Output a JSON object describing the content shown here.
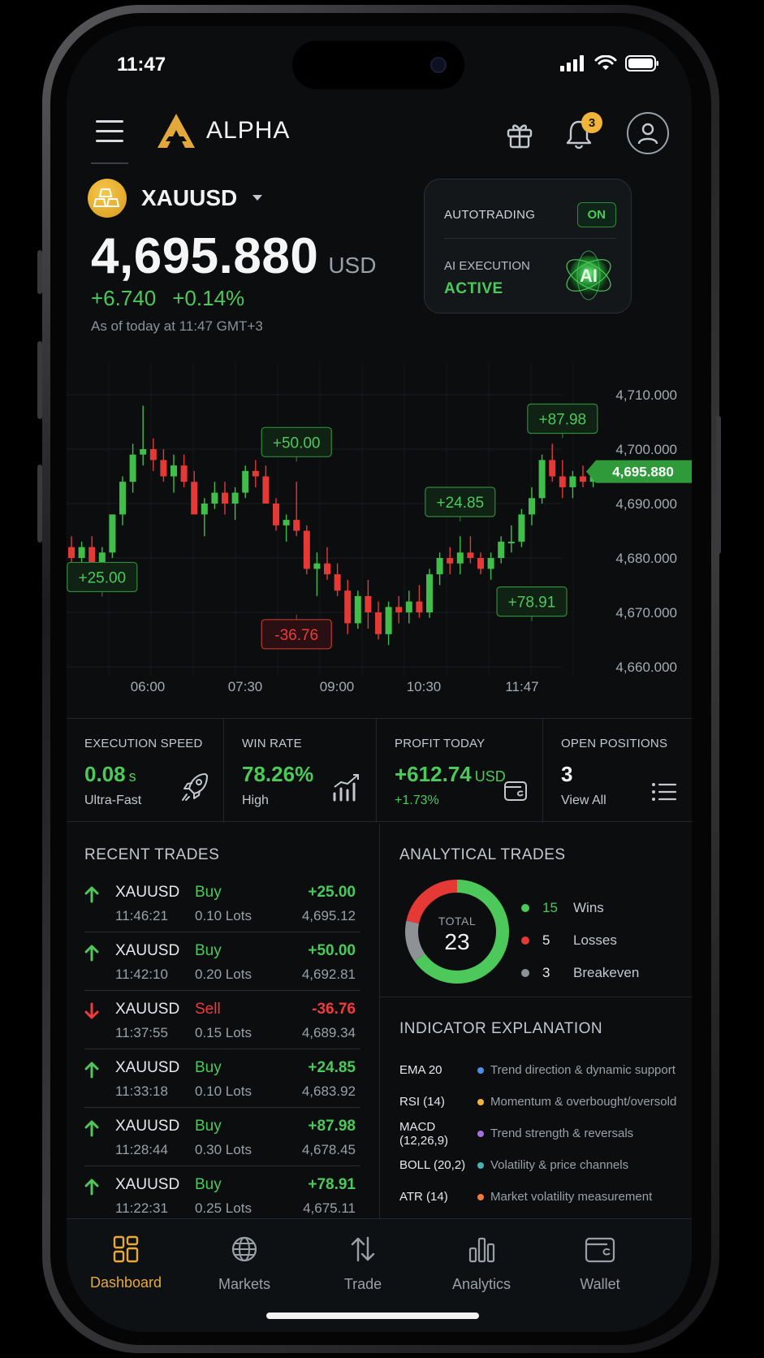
{
  "status_bar": {
    "time": "11:47"
  },
  "header": {
    "logo_text": "ALPHA",
    "notification_count": "3"
  },
  "symbol": {
    "name": "XAUUSD"
  },
  "quote": {
    "price": "4,695.880",
    "currency": "USD",
    "change_abs": "+6.740",
    "change_pct": "+0.14%",
    "as_of": "As of today at 11:47 GMT+3"
  },
  "autotrading": {
    "label": "AUTOTRADING",
    "toggle": "ON",
    "ai_label": "AI EXECUTION",
    "ai_status": "ACTIVE",
    "ai_badge": "AI"
  },
  "chart_data": {
    "type": "candlestick",
    "x_ticks": [
      "06:00",
      "07:30",
      "09:00",
      "10:30",
      "11:47"
    ],
    "y_ticks": [
      "4,710.000",
      "4,700.000",
      "4,690.000",
      "4,680.000",
      "4,670.000",
      "4,660.000"
    ],
    "ylim": [
      4660,
      4710
    ],
    "current_price_label": "4,695.880",
    "current_price": 4695.88,
    "annotations": [
      {
        "text": "+25.00",
        "color": "green",
        "idx": 3,
        "value": 4676.5
      },
      {
        "text": "+50.00",
        "color": "green",
        "idx": 22,
        "value": 4701.3
      },
      {
        "text": "-36.76",
        "color": "red",
        "idx": 22,
        "value": 4666.0
      },
      {
        "text": "+24.85",
        "color": "green",
        "idx": 38,
        "value": 4690.3
      },
      {
        "text": "+78.91",
        "color": "green",
        "idx": 45,
        "value": 4672.0
      },
      {
        "text": "+87.98",
        "color": "green",
        "idx": 48,
        "value": 4705.6
      }
    ],
    "candles": [
      [
        4682,
        4684,
        4678,
        4680
      ],
      [
        4680,
        4683,
        4678,
        4682
      ],
      [
        4682,
        4684,
        4679,
        4679
      ],
      [
        4679,
        4682,
        4677,
        4681
      ],
      [
        4681,
        4688,
        4680,
        4688
      ],
      [
        4688,
        4695,
        4686,
        4694
      ],
      [
        4694,
        4701,
        4692,
        4699
      ],
      [
        4699,
        4708,
        4697,
        4700
      ],
      [
        4700,
        4702,
        4696,
        4698
      ],
      [
        4698,
        4700,
        4694,
        4695
      ],
      [
        4695,
        4699,
        4692,
        4697
      ],
      [
        4697,
        4699,
        4693,
        4694
      ],
      [
        4694,
        4696,
        4688,
        4688
      ],
      [
        4688,
        4691,
        4684,
        4690
      ],
      [
        4690,
        4694,
        4689,
        4692
      ],
      [
        4692,
        4694,
        4688,
        4690
      ],
      [
        4690,
        4693,
        4687,
        4692
      ],
      [
        4692,
        4697,
        4691,
        4696
      ],
      [
        4696,
        4698,
        4693,
        4695
      ],
      [
        4695,
        4697,
        4690,
        4690
      ],
      [
        4690,
        4691,
        4685,
        4686
      ],
      [
        4686,
        4688,
        4683,
        4687
      ],
      [
        4687,
        4694,
        4684,
        4685
      ],
      [
        4685,
        4686,
        4677,
        4678
      ],
      [
        4678,
        4681,
        4673,
        4679
      ],
      [
        4679,
        4682,
        4676,
        4677
      ],
      [
        4677,
        4679,
        4673,
        4674
      ],
      [
        4674,
        4676,
        4666,
        4668
      ],
      [
        4668,
        4674,
        4667,
        4673
      ],
      [
        4673,
        4676,
        4667,
        4670
      ],
      [
        4670,
        4672,
        4665,
        4666
      ],
      [
        4666,
        4672,
        4664,
        4671
      ],
      [
        4671,
        4673,
        4668,
        4670
      ],
      [
        4670,
        4674,
        4668,
        4672
      ],
      [
        4672,
        4675,
        4669,
        4670
      ],
      [
        4670,
        4678,
        4669,
        4677
      ],
      [
        4677,
        4681,
        4675,
        4680
      ],
      [
        4680,
        4682,
        4677,
        4679
      ],
      [
        4679,
        4684,
        4677,
        4681
      ],
      [
        4681,
        4684,
        4679,
        4680
      ],
      [
        4680,
        4681,
        4677,
        4678
      ],
      [
        4678,
        4681,
        4676,
        4680
      ],
      [
        4680,
        4684,
        4679,
        4683
      ],
      [
        4683,
        4686,
        4681,
        4683
      ],
      [
        4683,
        4689,
        4682,
        4688
      ],
      [
        4688,
        4693,
        4686,
        4691
      ],
      [
        4691,
        4699,
        4690,
        4698
      ],
      [
        4698,
        4701,
        4694,
        4695
      ],
      [
        4695,
        4698,
        4691,
        4693
      ],
      [
        4693,
        4696,
        4691,
        4695
      ],
      [
        4695,
        4697,
        4693,
        4694
      ],
      [
        4694,
        4697,
        4693,
        4695
      ]
    ]
  },
  "stats": {
    "execution_speed": {
      "label": "EXECUTION SPEED",
      "value": "0.08",
      "unit": "s",
      "sub": "Ultra-Fast"
    },
    "win_rate": {
      "label": "WIN RATE",
      "value": "78.26%",
      "sub": "High"
    },
    "profit_today": {
      "label": "PROFIT TODAY",
      "value": "+612.74",
      "unit": "USD",
      "sub": "+1.73%"
    },
    "open_positions": {
      "label": "OPEN POSITIONS",
      "value": "3",
      "sub": "View All"
    }
  },
  "recent_trades": {
    "title": "RECENT TRADES",
    "trades": [
      {
        "symbol": "XAUUSD",
        "time": "11:46:21",
        "side": "Buy",
        "lots": "0.10 Lots",
        "pnl": "+25.00",
        "price": "4,695.12",
        "dir": "up"
      },
      {
        "symbol": "XAUUSD",
        "time": "11:42:10",
        "side": "Buy",
        "lots": "0.20 Lots",
        "pnl": "+50.00",
        "price": "4,692.81",
        "dir": "up"
      },
      {
        "symbol": "XAUUSD",
        "time": "11:37:55",
        "side": "Sell",
        "lots": "0.15 Lots",
        "pnl": "-36.76",
        "price": "4,689.34",
        "dir": "down"
      },
      {
        "symbol": "XAUUSD",
        "time": "11:33:18",
        "side": "Buy",
        "lots": "0.10 Lots",
        "pnl": "+24.85",
        "price": "4,683.92",
        "dir": "up"
      },
      {
        "symbol": "XAUUSD",
        "time": "11:28:44",
        "side": "Buy",
        "lots": "0.30 Lots",
        "pnl": "+87.98",
        "price": "4,678.45",
        "dir": "up"
      },
      {
        "symbol": "XAUUSD",
        "time": "11:22:31",
        "side": "Buy",
        "lots": "0.25 Lots",
        "pnl": "+78.91",
        "price": "4,675.11",
        "dir": "up"
      }
    ]
  },
  "analytical": {
    "title": "ANALYTICAL TRADES",
    "total_label": "TOTAL",
    "total": "23",
    "wins": {
      "count": "15",
      "label": "Wins",
      "color": "#4cc95a",
      "value": 15
    },
    "losses": {
      "count": "5",
      "label": "Losses",
      "color": "#e53935",
      "value": 5
    },
    "breakeven": {
      "count": "3",
      "label": "Breakeven",
      "color": "#8e9297",
      "value": 3
    }
  },
  "indicators": {
    "title": "INDICATOR EXPLANATION",
    "items": [
      {
        "name": "EMA 20",
        "desc": "Trend direction & dynamic support",
        "color": "#4a90e2"
      },
      {
        "name": "RSI (14)",
        "desc": "Momentum & overbought/oversold",
        "color": "#f0b43a"
      },
      {
        "name": "MACD (12,26,9)",
        "desc": "Trend strength & reversals",
        "color": "#a66ee0"
      },
      {
        "name": "BOLL (20,2)",
        "desc": "Volatility & price channels",
        "color": "#4ab0b8"
      },
      {
        "name": "ATR (14)",
        "desc": "Market volatility measurement",
        "color": "#f07a3a"
      }
    ]
  },
  "nav": {
    "dashboard": "Dashboard",
    "markets": "Markets",
    "trade": "Trade",
    "analytics": "Analytics",
    "wallet": "Wallet"
  }
}
